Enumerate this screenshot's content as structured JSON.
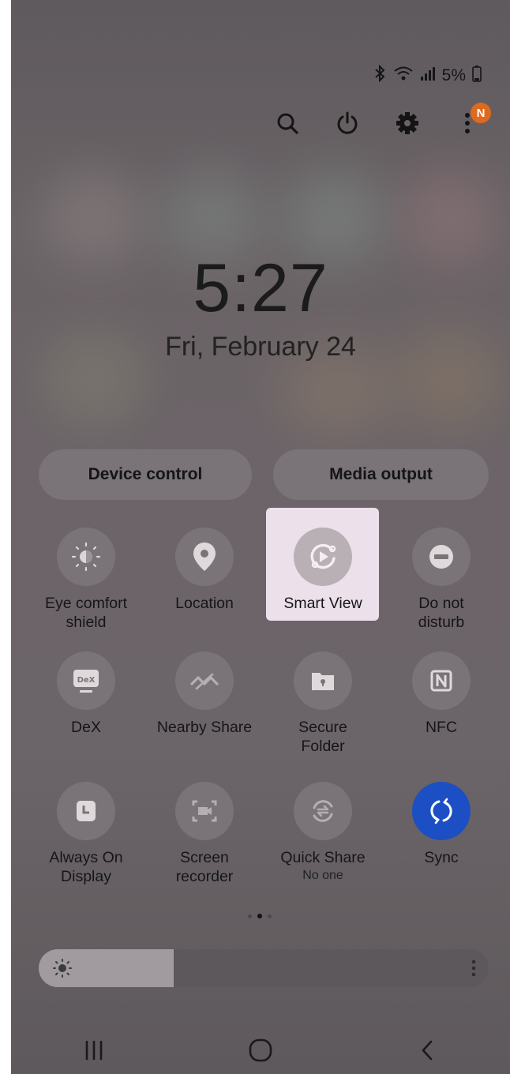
{
  "status_bar": {
    "battery": "5%",
    "icons": [
      "bluetooth-icon",
      "wifi-icon",
      "signal-icon",
      "battery-icon"
    ]
  },
  "top_actions": {
    "icons": [
      "search-icon",
      "power-icon",
      "settings-icon",
      "more-icon"
    ],
    "notification_badge": "N"
  },
  "clock": {
    "time": "5:27",
    "date": "Fri, February 24"
  },
  "buttons": {
    "device_control": "Device control",
    "media_output": "Media output"
  },
  "tiles": {
    "row1": [
      {
        "label": "Eye comfort shield",
        "icon": "eye-comfort-icon",
        "active": false
      },
      {
        "label": "Location",
        "icon": "location-pin-icon",
        "active": false
      },
      {
        "label": "Smart View",
        "icon": "smart-view-icon",
        "active": false,
        "highlighted": true
      },
      {
        "label": "Do not disturb",
        "icon": "do-not-disturb-icon",
        "active": false
      }
    ],
    "row2": [
      {
        "label": "DeX",
        "icon": "dex-icon",
        "active": false
      },
      {
        "label": "Nearby Share",
        "icon": "nearby-share-icon",
        "active": false
      },
      {
        "label": "Secure Folder",
        "icon": "secure-folder-icon",
        "active": false
      },
      {
        "label": "NFC",
        "icon": "nfc-icon",
        "active": false
      }
    ],
    "row3": [
      {
        "label": "Always On Display",
        "icon": "always-on-display-icon",
        "active": false
      },
      {
        "label": "Screen recorder",
        "icon": "screen-recorder-icon",
        "active": false
      },
      {
        "label": "Quick Share",
        "sublabel": "No one",
        "icon": "quick-share-icon",
        "active": false
      },
      {
        "label": "Sync",
        "icon": "sync-icon",
        "active": true
      }
    ]
  },
  "page_indicator": {
    "pages": 3,
    "current": 2
  },
  "brightness": {
    "level": 0.3
  },
  "navigation": {
    "icons": [
      "recents-icon",
      "home-icon",
      "back-icon"
    ]
  },
  "colors": {
    "active_tile": "#1d4fc4",
    "badge": "#e06a1b",
    "highlight": "#ece0eb"
  }
}
